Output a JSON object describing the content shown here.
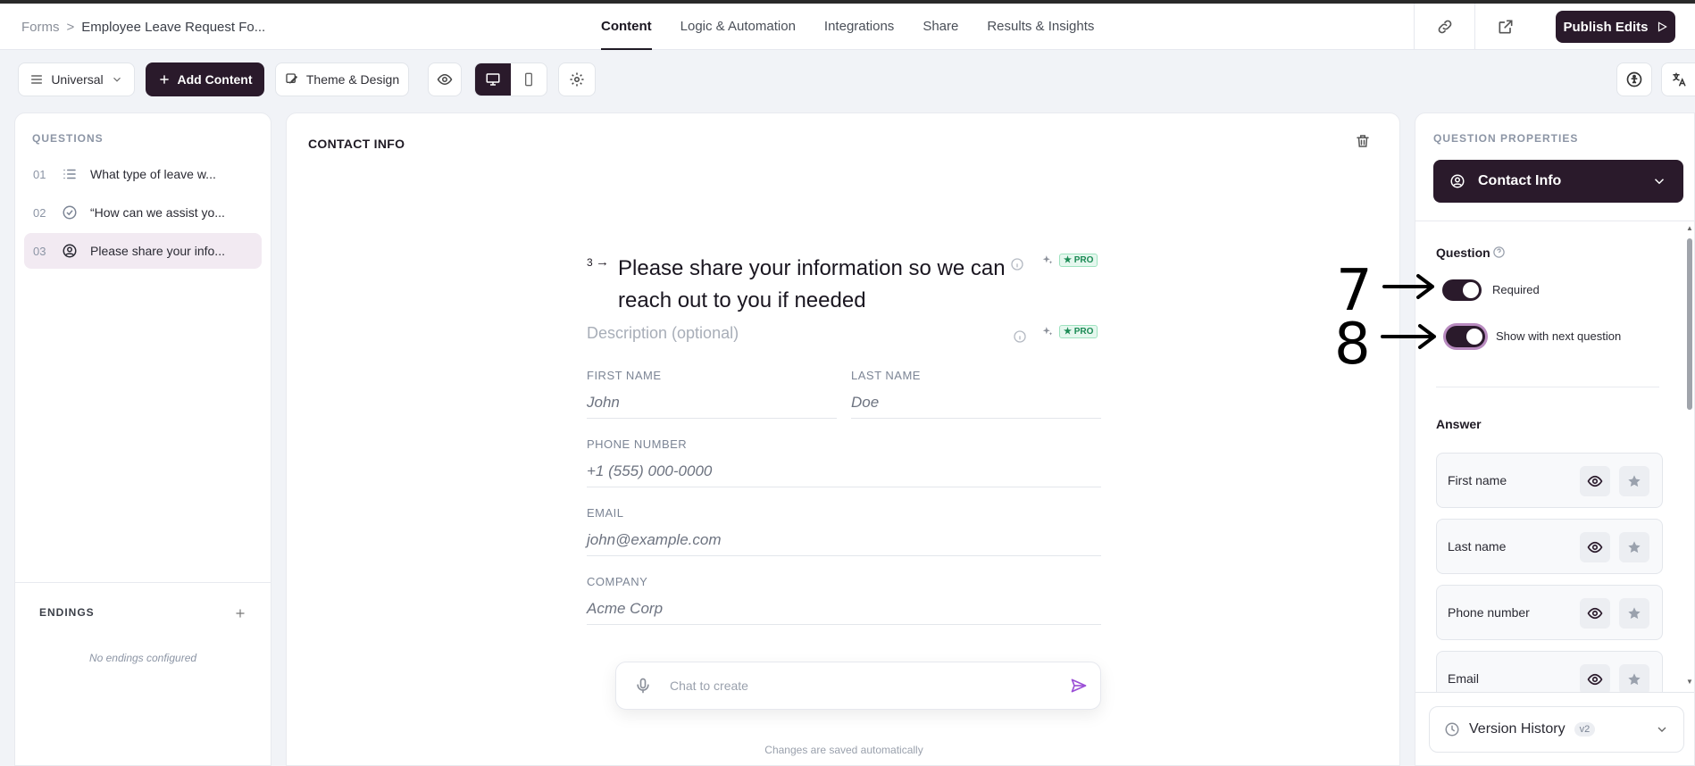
{
  "breadcrumb": {
    "root": "Forms",
    "separator": ">",
    "current": "Employee Leave Request Fo..."
  },
  "nav_tabs": [
    {
      "label": "Content",
      "active": true
    },
    {
      "label": "Logic & Automation",
      "active": false
    },
    {
      "label": "Integrations",
      "active": false
    },
    {
      "label": "Share",
      "active": false
    },
    {
      "label": "Results & Insights",
      "active": false
    }
  ],
  "header": {
    "publish_label": "Publish Edits"
  },
  "toolbar": {
    "mode_label": "Universal",
    "add_content_label": "Add Content",
    "theme_label": "Theme & Design",
    "device_selected": "desktop"
  },
  "left_panel": {
    "questions_label": "QUESTIONS",
    "questions": [
      {
        "num": "01",
        "icon": "list-icon",
        "text": "What type of leave w...",
        "selected": false
      },
      {
        "num": "02",
        "icon": "check-circle-icon",
        "text": "“How can we assist yo...",
        "selected": false
      },
      {
        "num": "03",
        "icon": "user-circle-icon",
        "text": "Please share your info...",
        "selected": true
      }
    ],
    "endings_label": "ENDINGS",
    "endings_empty": "No endings configured"
  },
  "canvas": {
    "section_title": "CONTACT INFO",
    "question_number": "3",
    "question_title": "Please share your information so we can reach out to you if needed",
    "description_placeholder": "Description (optional)",
    "pro_badge": "★ PRO",
    "fields": {
      "first_name": {
        "label": "FIRST NAME",
        "placeholder": "John"
      },
      "last_name": {
        "label": "LAST NAME",
        "placeholder": "Doe"
      },
      "phone": {
        "label": "PHONE NUMBER",
        "placeholder": "+1 (555) 000-0000"
      },
      "email": {
        "label": "EMAIL",
        "placeholder": "john@example.com"
      },
      "company": {
        "label": "COMPANY",
        "placeholder": "Acme Corp"
      }
    },
    "chat_placeholder": "Chat to create",
    "saved_note": "Changes are saved automatically"
  },
  "right_panel": {
    "properties_label": "QUESTION PROPERTIES",
    "type_label": "Contact Info",
    "question_section": "Question",
    "toggles": [
      {
        "label": "Required",
        "on": true
      },
      {
        "label": "Show with next question",
        "on": true
      }
    ],
    "answer_section": "Answer",
    "answers": [
      {
        "label": "First name"
      },
      {
        "label": "Last name"
      },
      {
        "label": "Phone number"
      },
      {
        "label": "Email"
      }
    ],
    "version_label": "Version History",
    "version_badge": "v2"
  },
  "annotations": [
    {
      "number": "7"
    },
    {
      "number": "8"
    }
  ],
  "colors": {
    "brand_dark": "#2a1a2b",
    "pro_green": "#1a8a54",
    "focus_ring": "#b98bc0",
    "send_purple": "#9b4fd6"
  }
}
